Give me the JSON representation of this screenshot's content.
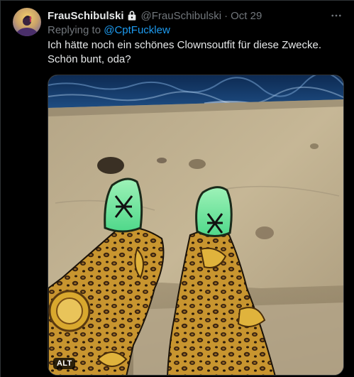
{
  "tweet": {
    "display_name": "FrauSchibulski",
    "handle": "@FrauSchibulski",
    "separator": "·",
    "date": "Oct 29",
    "replying_label": "Replying to",
    "replying_to": "@CptFucklew",
    "text_line_1": "Ich hätte noch ein schönes Clownsoutfit für diese Zwecke.",
    "text_line_2": "Schön bunt, oda?",
    "media": {
      "alt_badge": "ALT"
    }
  },
  "icons": {
    "lock": "lock-icon",
    "more": "more-icon"
  },
  "colors": {
    "background": "#000000",
    "primary_text": "#e7e9ea",
    "secondary_text": "#71767b",
    "link": "#1d9bf0",
    "border": "#2f3336"
  }
}
